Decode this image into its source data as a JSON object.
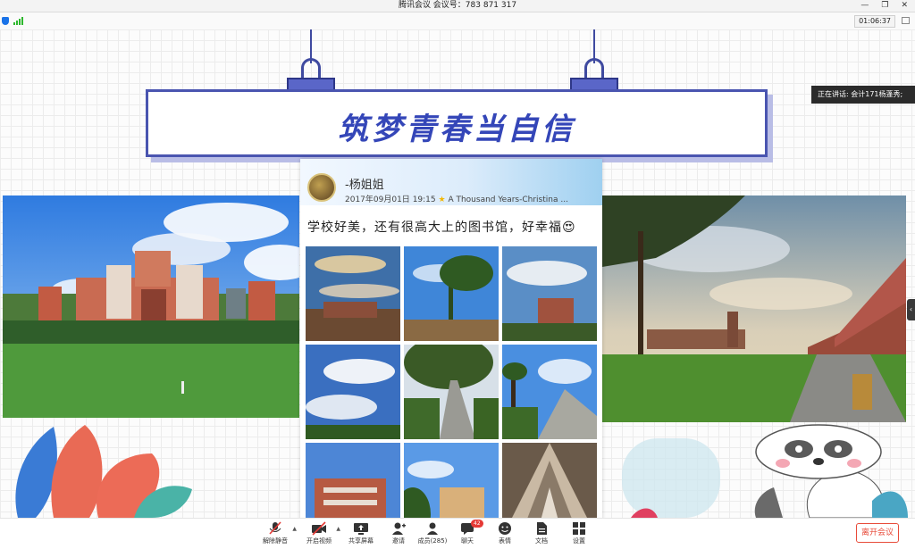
{
  "window": {
    "title": "腾讯会议 会议号：783 871 317",
    "meeting_timer": "01:06:37"
  },
  "slide": {
    "banner_title": "筑梦青春当自信",
    "post": {
      "username": "-杨姐姐",
      "date": "2017年09月01日",
      "time": "19:15",
      "song": "A Thousand Years-Christina ...",
      "text": "学校好美，还有很高大上的图书馆，好幸福😍"
    }
  },
  "speaking": {
    "label": "正在讲话: 会计171杨蓬秀;"
  },
  "toolbar": {
    "unmute": "解除静音",
    "start_video": "开启视频",
    "share_screen": "共享屏幕",
    "invite": "邀请",
    "members": "成员(285)",
    "chat": "聊天",
    "chat_badge": "42",
    "reactions": "表情",
    "documents": "文档",
    "settings": "设置",
    "leave": "离开会议"
  },
  "colors": {
    "accent": "#3446b8",
    "leave": "#e84b3a",
    "signal": "#2eb82e"
  }
}
